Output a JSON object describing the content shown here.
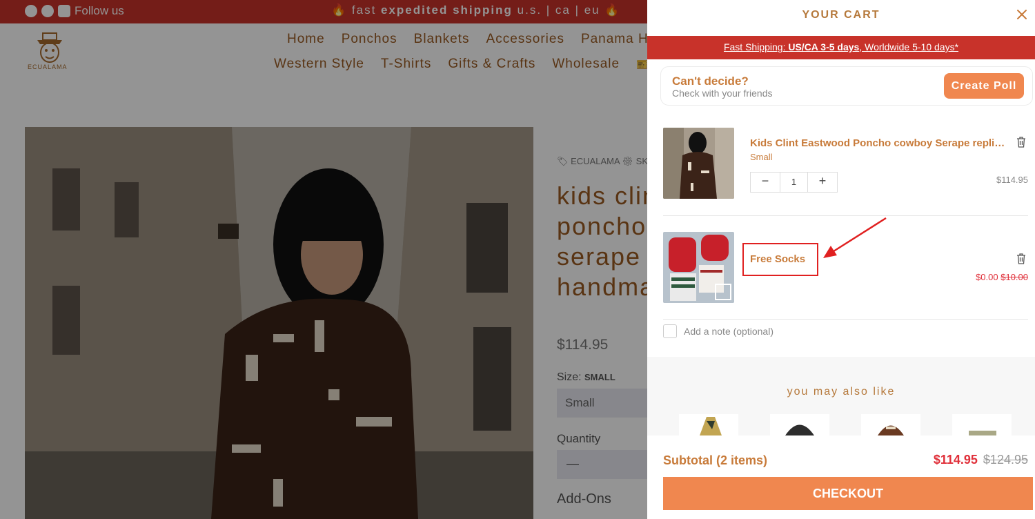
{
  "topbar": {
    "follow": "Follow us",
    "promo_pre": "🔥 fast ",
    "promo_bold": "expedited shipping",
    "promo_post": " u.s. | ca | eu 🔥"
  },
  "logo": {
    "text": "ECUALAMA"
  },
  "nav": {
    "row1": [
      "Home",
      "Ponchos",
      "Blankets",
      "Accessories",
      "Panama Hats"
    ],
    "row2": [
      "Western Style",
      "T-Shirts",
      "Gifts & Crafts",
      "Wholesale",
      "🎫 SA"
    ]
  },
  "product": {
    "brand": "🏷 ECUALAMA   ⚙ SK",
    "title": "kids clint eastwood poncho cowboy serape replica handmade unisex -",
    "price": "$114.95",
    "size_label": "Size: ",
    "size_value": "SMALL",
    "size_select": "Small",
    "qty_label": "Quantity",
    "qty_value": "—",
    "addons": "Add-Ons"
  },
  "cart": {
    "title": "YOUR CART",
    "banner": {
      "pre": "Fast Shipping: ",
      "bold": "US/CA 3-5 days",
      "post": ", Worldwide 5-10 days*"
    },
    "poll": {
      "heading": "Can't decide?",
      "sub": "Check with your friends",
      "button": "Create Poll"
    },
    "items": [
      {
        "name": "Kids Clint Eastwood Poncho cowboy Serape replica handmade unisex",
        "variant": "Small",
        "qty": "1",
        "minus": "−",
        "plus": "+",
        "price": "$114.95"
      },
      {
        "name": "Free Socks",
        "price": "$0.00",
        "compare": "$10.00"
      }
    ],
    "note": "Add a note (optional)",
    "also_like": "you may also like",
    "subtotal": "Subtotal (2 items)",
    "total": "$114.95",
    "total_compare": "$124.95",
    "checkout": "CHECKOUT"
  },
  "colors": {
    "brand_red": "#c8322a",
    "accent_orange": "#f0874f",
    "text_brown": "#c87b3a",
    "sale_red": "#e0303a"
  }
}
